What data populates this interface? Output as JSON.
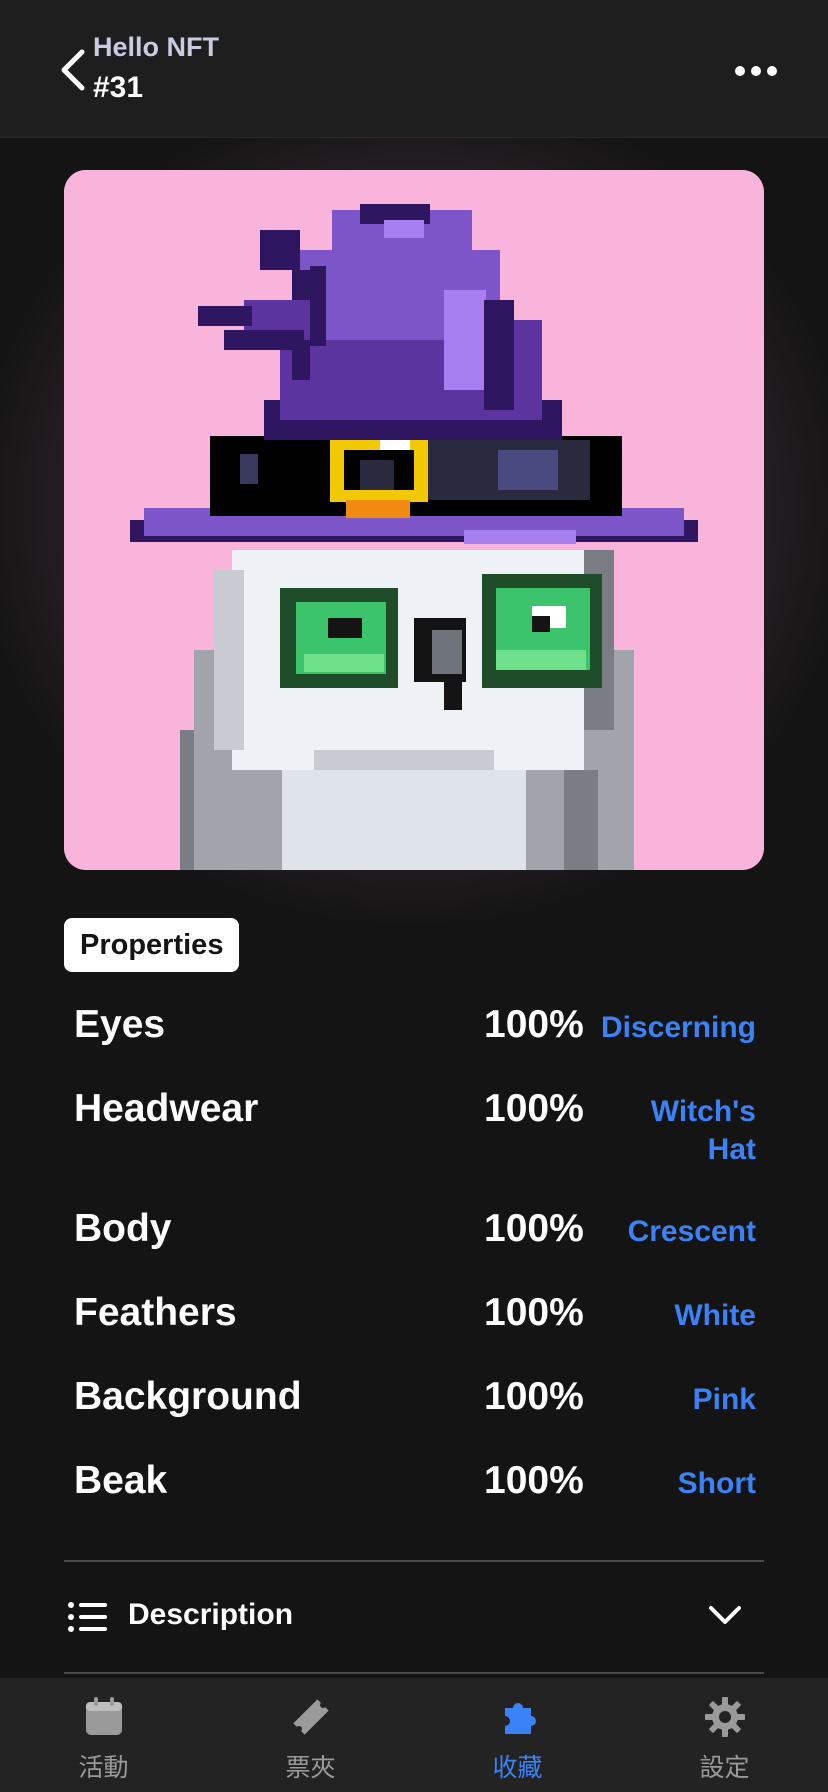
{
  "header": {
    "title": "Hello NFT",
    "subtitle": "#31",
    "back_icon": "chevron-left-icon",
    "more_icon": "ellipsis-icon"
  },
  "properties_label": "Properties",
  "properties": [
    {
      "name": "Eyes",
      "percent": "100%",
      "value": "Discerning"
    },
    {
      "name": "Headwear",
      "percent": "100%",
      "value": "Witch's Hat"
    },
    {
      "name": "Body",
      "percent": "100%",
      "value": "Crescent"
    },
    {
      "name": "Feathers",
      "percent": "100%",
      "value": "White"
    },
    {
      "name": "Background",
      "percent": "100%",
      "value": "Pink"
    },
    {
      "name": "Beak",
      "percent": "100%",
      "value": "Short"
    }
  ],
  "description": {
    "label": "Description",
    "icon": "list-icon",
    "toggle_icon": "chevron-down-icon"
  },
  "nav": [
    {
      "label": "活動",
      "icon": "calendar-icon",
      "active": false
    },
    {
      "label": "票夾",
      "icon": "ticket-icon",
      "active": false
    },
    {
      "label": "收藏",
      "icon": "puzzle-icon",
      "active": true
    },
    {
      "label": "設定",
      "icon": "gear-icon",
      "active": false
    }
  ],
  "colors": {
    "accent": "#3b82f6",
    "background": "#141414",
    "nft_background": "#f9b4dc",
    "hat_purple": "#7c56c8",
    "eye_green": "#3cc46c"
  }
}
